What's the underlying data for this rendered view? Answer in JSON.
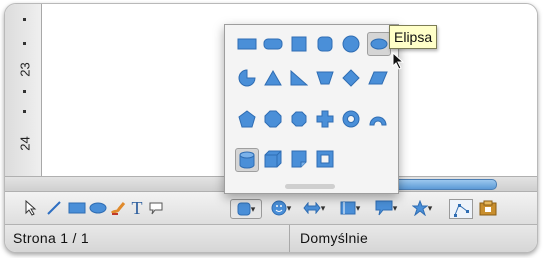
{
  "ruler": {
    "marks": [
      "23",
      "24"
    ]
  },
  "tooltip": {
    "text": "Elipsa"
  },
  "palette": {
    "accent": "#4a8fd8",
    "rows": [
      [
        "rectangle",
        "rounded-rectangle",
        "square",
        "rounded-square",
        "circle",
        "ellipse"
      ],
      [
        "circle-pie",
        "isosceles-triangle",
        "right-triangle",
        "trapezoid",
        "diamond",
        "parallelogram"
      ],
      [
        "pentagon",
        "octagon",
        "octagon-small",
        "cross",
        "ring",
        "block-arc"
      ],
      [
        "can",
        "cube",
        "folded-corner",
        "frame"
      ]
    ]
  },
  "toolbar": {
    "icons": [
      "select-arrow-icon",
      "line-icon",
      "rectangle-icon",
      "ellipse-icon",
      "freeform-icon",
      "text-icon",
      "callout-icon",
      "basic-shapes-icon",
      "symbol-shapes-icon",
      "block-arrows-icon",
      "flowchart-icon",
      "callouts-icon",
      "stars-icon",
      "points-icon",
      "from-file-icon"
    ]
  },
  "status": {
    "page": "Strona  1 / 1",
    "style": "Domyślnie"
  }
}
